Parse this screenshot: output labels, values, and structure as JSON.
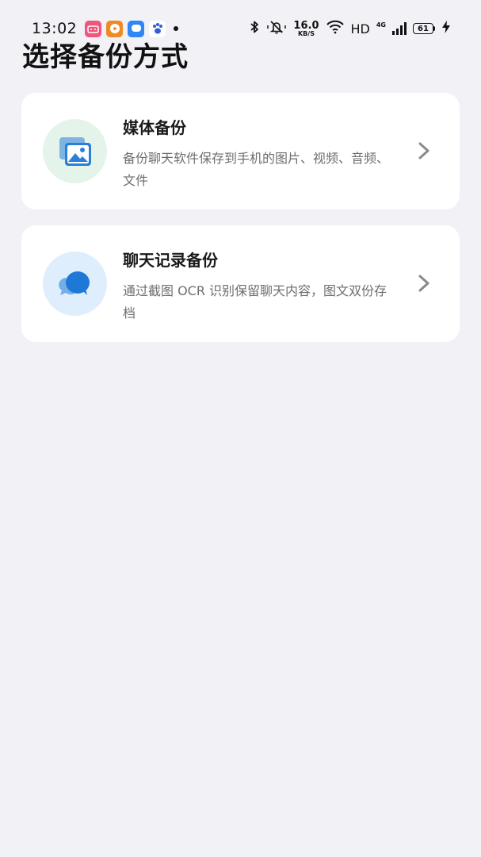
{
  "status_bar": {
    "time": "13:02",
    "net_speed_value": "16.0",
    "net_speed_unit": "KB/S",
    "hd_label": "HD",
    "network_type": "4G",
    "battery_level": "61"
  },
  "page": {
    "title": "选择备份方式"
  },
  "options": [
    {
      "title": "媒体备份",
      "description": "备份聊天软件保存到手机的图片、视频、音频、文件",
      "icon": "image-gallery-icon",
      "icon_color": "#2a7fd8",
      "icon_bg": "#e5f4ea"
    },
    {
      "title": "聊天记录备份",
      "description": "通过截图 OCR 识别保留聊天内容，图文双份存档",
      "icon": "chat-bubbles-icon",
      "icon_color": "#1e78d6",
      "icon_bg": "#dfeefc"
    }
  ]
}
